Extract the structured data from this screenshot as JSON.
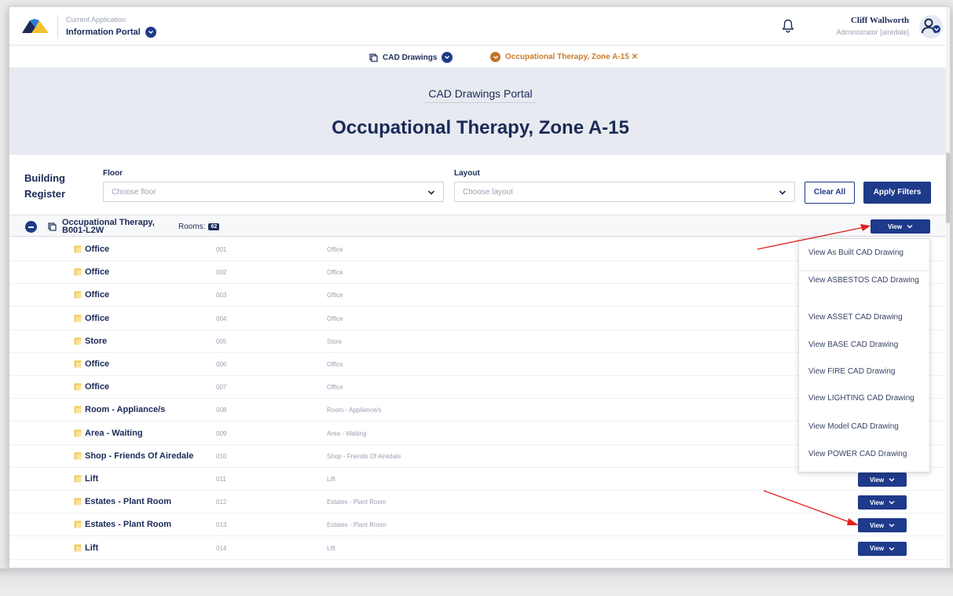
{
  "header": {
    "app_label": "Current Application",
    "app_name": "Information Portal",
    "user_name": "Cliff Wallworth",
    "user_role": "Administrator [airedale]"
  },
  "breadcrumb": {
    "first": "CAD Drawings",
    "second": "Occupational Therapy, Zone A-15 ✕"
  },
  "hero": {
    "portal_title": "CAD Drawings Portal",
    "page_title": "Occupational Therapy, Zone A-15"
  },
  "filters": {
    "register_label_line1": "Building",
    "register_label_line2": "Register",
    "floor_label": "Floor",
    "floor_placeholder": "Choose floor",
    "layout_label": "Layout",
    "layout_placeholder": "Choose layout",
    "clear_label": "Clear All",
    "apply_label": "Apply Filters"
  },
  "group": {
    "name": "Occupational Therapy, B001-L2W",
    "rooms_label": "Rooms:",
    "rooms_count": "62",
    "view_label": "View"
  },
  "rows": [
    {
      "name": "Office",
      "num": "001",
      "desc": "Office",
      "view": ""
    },
    {
      "name": "Office",
      "num": "002",
      "desc": "Office",
      "view": ""
    },
    {
      "name": "Office",
      "num": "003",
      "desc": "Office",
      "view": ""
    },
    {
      "name": "Office",
      "num": "004",
      "desc": "Office",
      "view": ""
    },
    {
      "name": "Store",
      "num": "005",
      "desc": "Store",
      "view": ""
    },
    {
      "name": "Office",
      "num": "006",
      "desc": "Office",
      "view": ""
    },
    {
      "name": "Office",
      "num": "007",
      "desc": "Office",
      "view": ""
    },
    {
      "name": "Room - Appliance/s",
      "num": "008",
      "desc": "Room - Appliance/s",
      "view": ""
    },
    {
      "name": "Area - Waiting",
      "num": "009",
      "desc": "Area - Waiting",
      "view": ""
    },
    {
      "name": "Shop - Friends Of Airedale",
      "num": "010",
      "desc": "Shop - Friends Of Airedale",
      "view": ""
    },
    {
      "name": "Lift",
      "num": "011",
      "desc": "Lift",
      "view": "View"
    },
    {
      "name": "Estates - Plant Room",
      "num": "012",
      "desc": "Estates - Plant Room",
      "view": "View"
    },
    {
      "name": "Estates - Plant Room",
      "num": "013",
      "desc": "Estates - Plant Room",
      "view": "View"
    },
    {
      "name": "Lift",
      "num": "014",
      "desc": "Lift",
      "view": "View"
    }
  ],
  "menu": [
    "View As Built CAD Drawing",
    "View ASBESTOS CAD Drawing",
    "View ASSET CAD Drawing",
    "View BASE CAD Drawing",
    "View FIRE CAD Drawing",
    "View LIGHTING CAD Drawing",
    "View Model CAD Drawing",
    "View POWER CAD Drawing"
  ],
  "colors": {
    "navy": "#1e3a8a",
    "text": "#1b2a57",
    "orange": "#c0722a",
    "room_icon": "#f3c94a",
    "annotation_arrow": "#e02020"
  }
}
